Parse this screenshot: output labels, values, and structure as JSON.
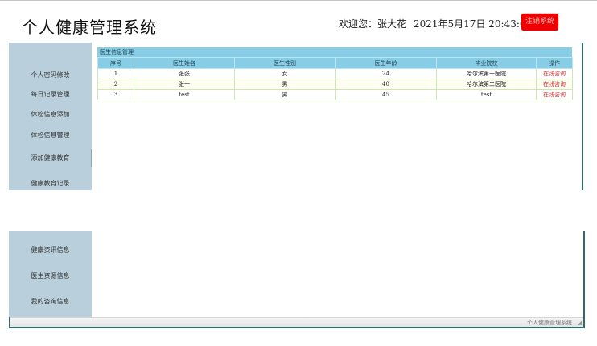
{
  "header": {
    "app_title": "个人健康管理系统",
    "welcome": "欢迎您：",
    "username": "张大花",
    "datetime": "2021年5月17日 20:43:06",
    "logout_label": "注销系统",
    "accent_color": "#ee0000"
  },
  "sidebar": {
    "items": [
      {
        "label": "个人密码修改"
      },
      {
        "label": "每日记录管理"
      },
      {
        "label": "体检信息添加"
      },
      {
        "label": "体检信息管理"
      },
      {
        "label": "添加健康教育"
      },
      {
        "label": "健康教育记录"
      },
      {
        "label": "健康资讯信息"
      },
      {
        "label": "医生资源信息"
      },
      {
        "label": "我的咨询信息"
      }
    ]
  },
  "panel": {
    "title": "医生信息管理",
    "columns": [
      "序号",
      "医生姓名",
      "医生性别",
      "医生年龄",
      "毕业院校",
      "操作"
    ],
    "rows": [
      {
        "no": "1",
        "name": "张张",
        "gender": "女",
        "age": "24",
        "school": "哈尔滨第一医院",
        "action": "在线咨询"
      },
      {
        "no": "2",
        "name": "张一",
        "gender": "男",
        "age": "40",
        "school": "哈尔滨第二医院",
        "action": "在线咨询"
      },
      {
        "no": "3",
        "name": "test",
        "gender": "男",
        "age": "45",
        "school": "test",
        "action": "在线咨询"
      }
    ]
  },
  "status_bar": {
    "text": "个人健康管理系统"
  }
}
